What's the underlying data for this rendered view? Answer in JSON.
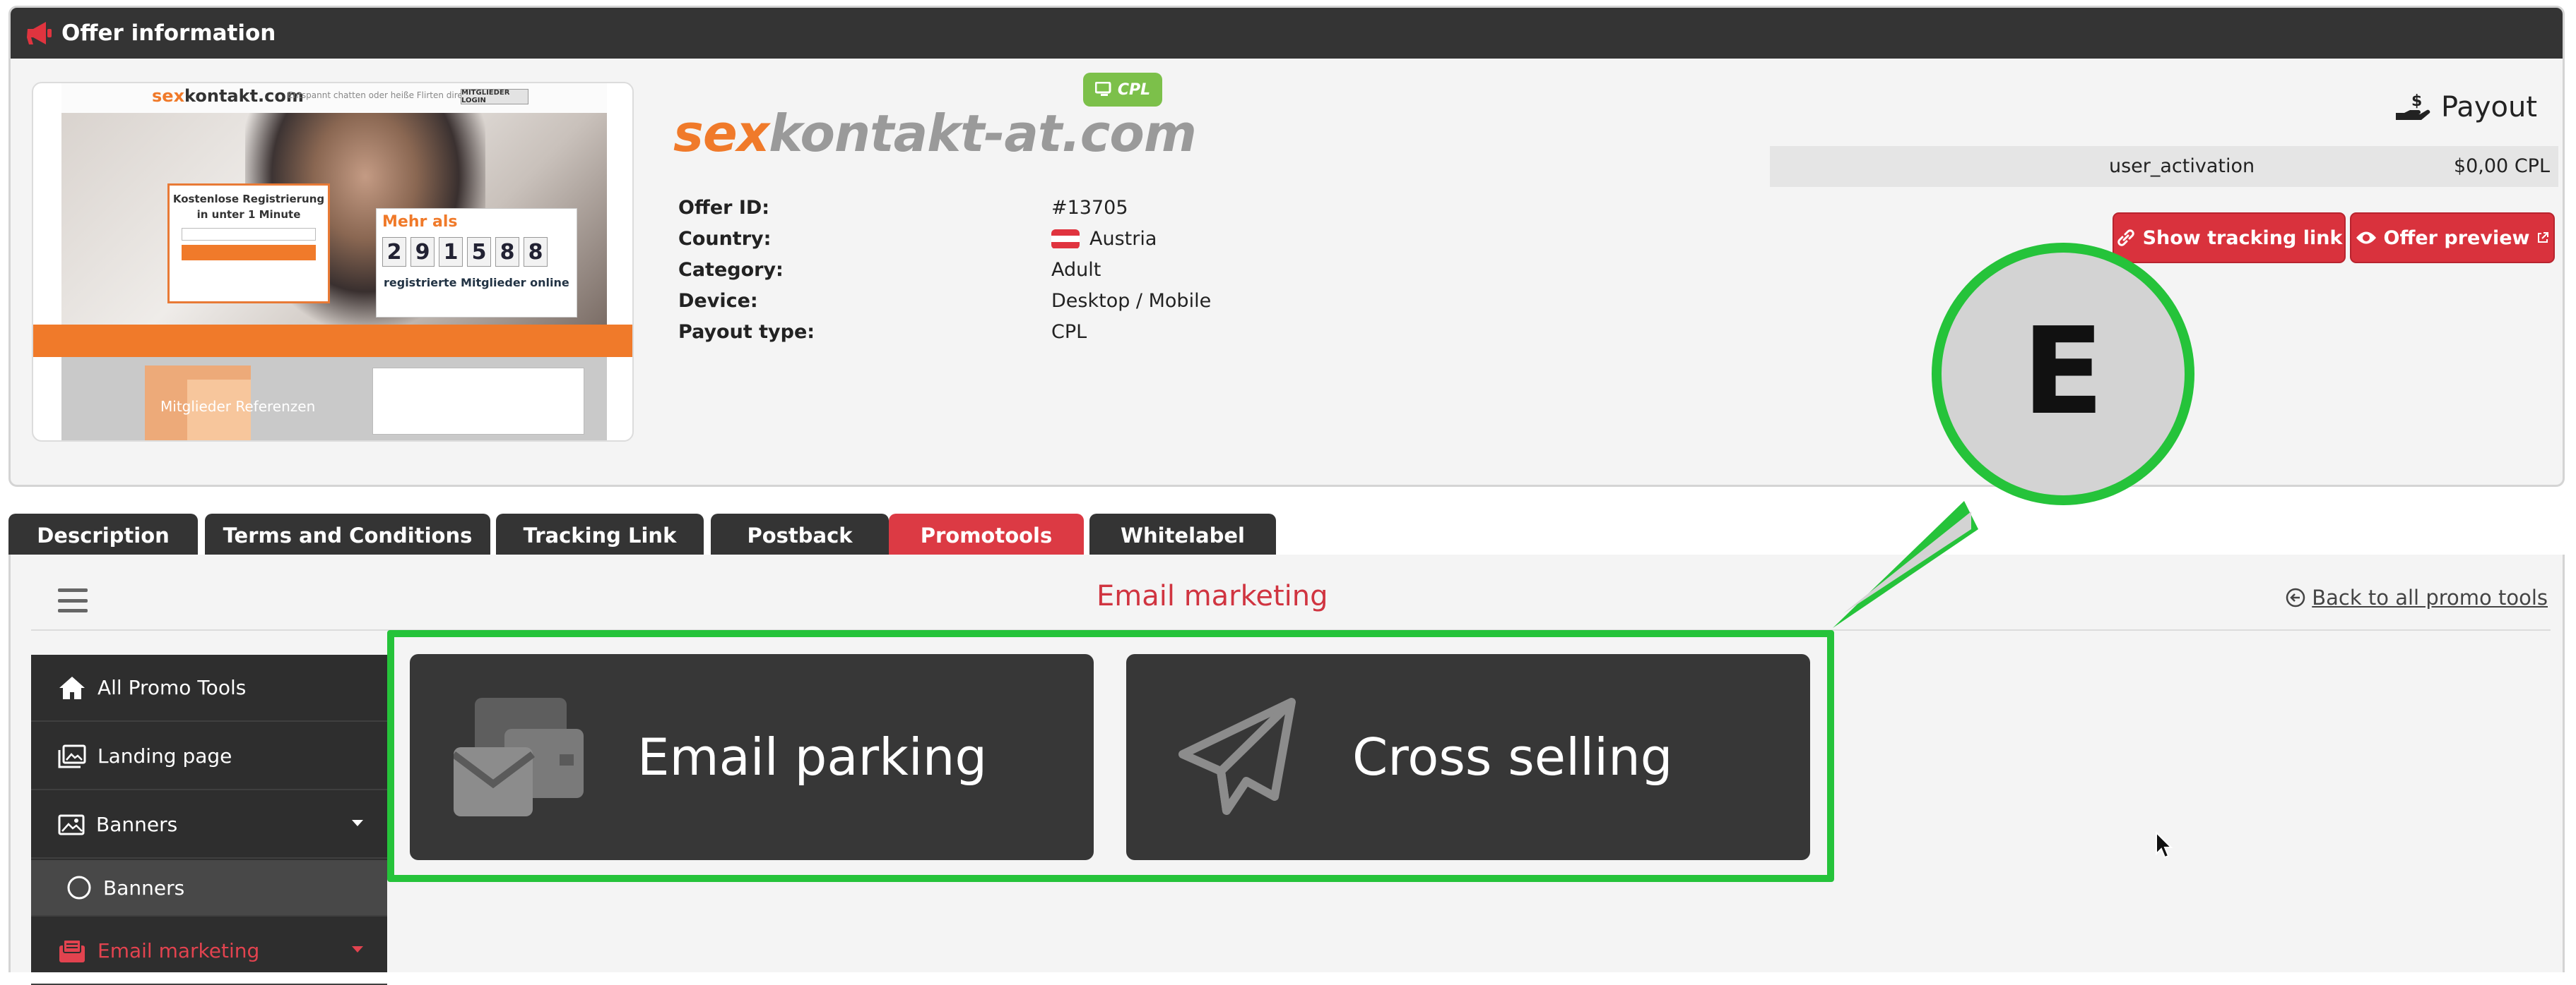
{
  "header": {
    "title": "Offer information"
  },
  "thumbnail": {
    "logo_prefix": "sex",
    "logo_suffix": "kontakt.com",
    "tagline": "Entspannt chatten oder heiße Flirten direkt heute!",
    "login_label": "MITGLIEDER LOGIN",
    "register_title": "Kostenlose Registrierung in unter 1 Minute",
    "more_than": "Mehr als",
    "count_digits": [
      "2",
      "9",
      "1",
      "5",
      "8",
      "8"
    ],
    "registered_text": "registrierte Mitglieder online",
    "members_ref": "Mitglieder Referenzen"
  },
  "offer": {
    "brand_prefix": "sex",
    "brand_suffix": "kontakt-at.com",
    "badge": "CPL",
    "fields": [
      {
        "label": "Offer ID:",
        "value": "#13705"
      },
      {
        "label": "Country:",
        "value": "Austria"
      },
      {
        "label": "Category:",
        "value": "Adult"
      },
      {
        "label": "Device:",
        "value": "Desktop / Mobile"
      },
      {
        "label": "Payout type:",
        "value": "CPL"
      }
    ]
  },
  "payout": {
    "title": "Payout",
    "event": "user_activation",
    "amount": "$0,00 CPL",
    "show_tracking_label": "Show tracking link",
    "offer_preview_label": "Offer preview"
  },
  "tabs": [
    {
      "label": "Description",
      "active": false
    },
    {
      "label": "Terms and Conditions",
      "active": false
    },
    {
      "label": "Tracking Link",
      "active": false
    },
    {
      "label": "Postback",
      "active": false
    },
    {
      "label": "Promotools",
      "active": true
    },
    {
      "label": "Whitelabel",
      "active": false
    }
  ],
  "promo": {
    "section_title": "Email marketing",
    "back_link": "Back to all promo tools",
    "sidebar": [
      {
        "label": "All Promo Tools",
        "icon": "home-icon"
      },
      {
        "label": "Landing page",
        "icon": "images-icon"
      },
      {
        "label": "Banners",
        "icon": "image-icon"
      },
      {
        "label": "Banners",
        "icon": "circle-icon"
      },
      {
        "label": "Email marketing",
        "icon": "mail-box-icon"
      }
    ],
    "cards": [
      {
        "label": "Email parking",
        "icon": "envelopes-icon"
      },
      {
        "label": "Cross selling",
        "icon": "paper-plane-icon"
      }
    ]
  },
  "annotation": {
    "callout_letter": "E"
  },
  "colors": {
    "accent_red": "#dc3a44",
    "highlight_green": "#25c33a",
    "dark": "#343434"
  }
}
